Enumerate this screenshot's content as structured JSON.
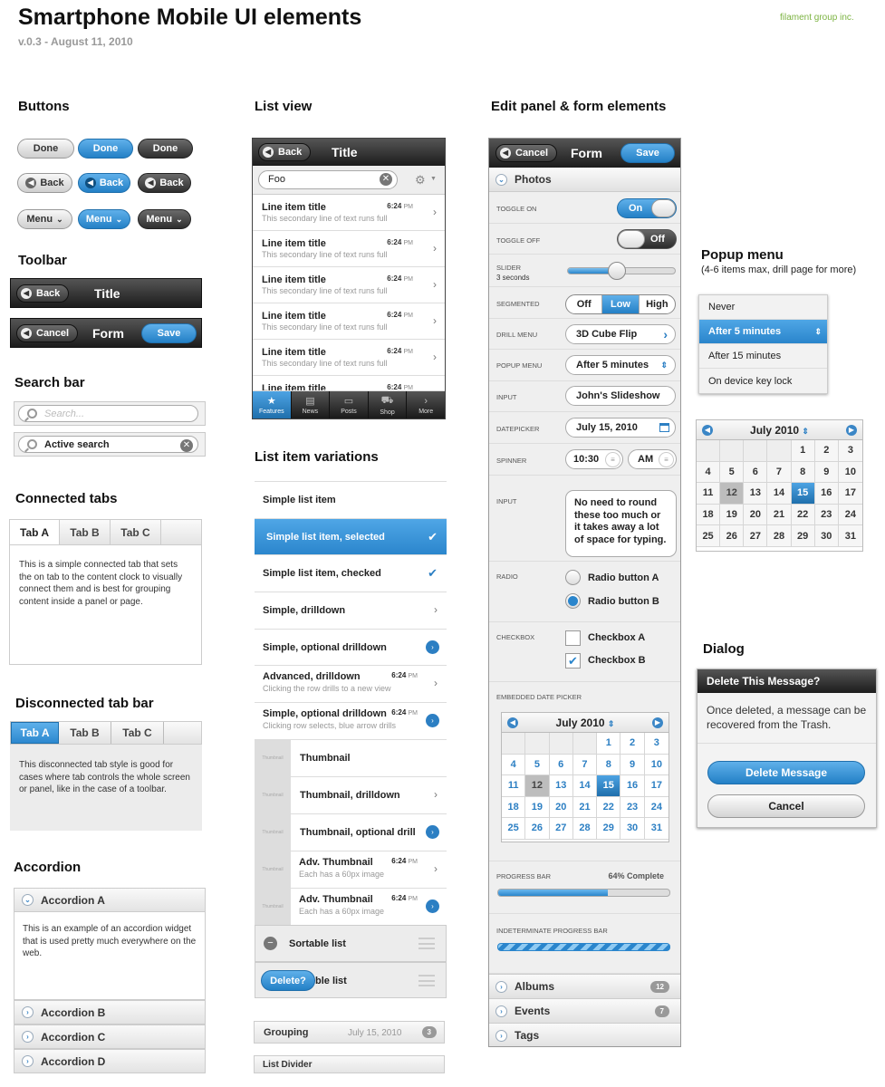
{
  "header": {
    "title": "Smartphone Mobile UI elements",
    "version": "v.0.3 - August 11, 2010",
    "brand": "filament group inc."
  },
  "sections": {
    "buttons": "Buttons",
    "toolbar": "Toolbar",
    "search_bar": "Search bar",
    "connected_tabs": "Connected tabs",
    "disconnected_tabs": "Disconnected tab bar",
    "accordion": "Accordion",
    "list_view": "List view",
    "list_variations": "List item variations",
    "edit_panel": "Edit panel & form elements",
    "popup_menu": "Popup menu",
    "popup_note": "(4-6 items max, drill page for more)",
    "dialog": "Dialog"
  },
  "buttons": {
    "done": "Done",
    "back": "Back",
    "menu": "Menu"
  },
  "toolbar": {
    "back": "Back",
    "title1": "Title",
    "cancel": "Cancel",
    "title2": "Form",
    "save": "Save"
  },
  "search": {
    "placeholder": "Search...",
    "active": "Active search"
  },
  "connected_tabs": {
    "tabs": [
      "Tab A",
      "Tab B",
      "Tab C"
    ],
    "text": "This is a simple connected tab that sets the on tab to the content clock to visually connect them and is best for grouping content inside a panel or page."
  },
  "disconnected_tabs": {
    "tabs": [
      "Tab A",
      "Tab B",
      "Tab C"
    ],
    "text": "This disconnected tab style is good for cases where tab controls the whole screen or panel, like in the case of a toolbar."
  },
  "accordion": {
    "a": "Accordion A",
    "text": "This is an example of an accordion widget that is used pretty much everywhere on the web.",
    "b": "Accordion B",
    "c": "Accordion C",
    "d": "Accordion D"
  },
  "listview": {
    "back": "Back",
    "title": "Title",
    "search_value": "Foo",
    "item_title": "Line item title",
    "item_sub": "This secondary line of text runs full",
    "time": "6:24",
    "ampm": "PM",
    "tabs": [
      "Features",
      "News",
      "Posts",
      "Shop",
      "More"
    ]
  },
  "variations": {
    "simple": "Simple list item",
    "selected": "Simple list item, selected",
    "checked": "Simple list item, checked",
    "drilldown": "Simple, drilldown",
    "opt_drill": "Simple, optional drilldown",
    "adv_drill": "Advanced, drilldown",
    "adv_drill_sub": "Clicking the row drills to a new view",
    "opt_drill2": "Simple, optional drilldown",
    "opt_drill2_sub": "Clicking row selects, blue arrow drills",
    "thumb_label": "Thumbnail",
    "thumbnail": "Thumbnail",
    "thumb_drill": "Thumbnail, drilldown",
    "thumb_opt": "Thumbnail, optional drill",
    "adv_thumb": "Adv. Thumbnail",
    "adv_thumb_sub": "Each has a 60px image",
    "time": "6:24",
    "ampm": "PM",
    "sortable": "Sortable list",
    "delete": "Delete?",
    "sortable_tail": "ble list",
    "grouping": "Grouping",
    "grouping_date": "July 15, 2010",
    "grouping_count": "3",
    "divider": "List Divider"
  },
  "form": {
    "cancel": "Cancel",
    "title": "Form",
    "save": "Save",
    "photos": "Photos",
    "toggle_on_label": "TOGGLE ON",
    "on": "On",
    "toggle_off_label": "TOGGLE OFF",
    "off": "Off",
    "slider_label": "SLIDER",
    "slider_sub": "3 seconds",
    "slider_value": 0.45,
    "segmented_label": "SEGMENTED",
    "seg": [
      "Off",
      "Low",
      "High"
    ],
    "drill_label": "DRILL MENU",
    "drill_value": "3D Cube Flip",
    "popup_label": "POPUP MENU",
    "popup_value": "After 5 minutes",
    "input_label": "INPUT",
    "input_value": "John's Slideshow",
    "date_label": "DATEPICKER",
    "date_value": "July 15, 2010",
    "spinner_label": "SPINNER",
    "spin_time": "10:30",
    "spin_ampm": "AM",
    "textarea_label": "INPUT",
    "textarea_value": "No need to round these too much or it takes away a lot of space for typing.",
    "radio_label": "RADIO",
    "radio_a": "Radio button A",
    "radio_b": "Radio button B",
    "checkbox_label": "CHECKBOX",
    "check_a": "Checkbox A",
    "check_b": "Checkbox B",
    "embedded_label": "EMBEDDED DATE PICKER",
    "progress_label": "PROGRESS BAR",
    "progress_text": "64% Complete",
    "progress": 0.64,
    "indeterminate_label": "INDETERMINATE PROGRESS BAR",
    "albums": "Albums",
    "albums_count": "12",
    "events": "Events",
    "events_count": "7",
    "tags": "Tags"
  },
  "calendar": {
    "month": "July 2010",
    "days": [
      "",
      "",
      "",
      "",
      "1",
      "2",
      "3",
      "4",
      "5",
      "6",
      "7",
      "8",
      "9",
      "10",
      "11",
      "12",
      "13",
      "14",
      "15",
      "16",
      "17",
      "18",
      "19",
      "20",
      "21",
      "22",
      "23",
      "24",
      "25",
      "26",
      "27",
      "28",
      "29",
      "30",
      "31"
    ],
    "today": "12",
    "selected": "15"
  },
  "popup": {
    "items": [
      "Never",
      "After 5 minutes",
      "After 15 minutes",
      "On device key lock"
    ]
  },
  "dialog": {
    "title": "Delete This Message?",
    "text": "Once deleted, a message can be recovered from the Trash.",
    "delete": "Delete Message",
    "cancel": "Cancel"
  },
  "colors": {
    "accent": "#2a85cc",
    "brand": "#7cb342",
    "dark": "#2e2e2e"
  }
}
